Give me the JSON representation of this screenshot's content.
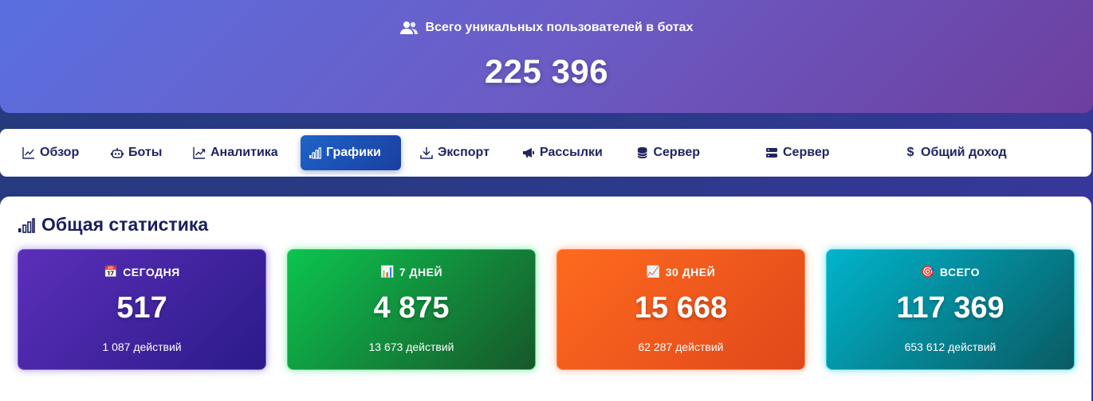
{
  "hero": {
    "icon": "users-icon",
    "label": "Всего уникальных пользователей в ботах",
    "value": "225 396"
  },
  "nav": {
    "tabs": [
      {
        "label": "Обзор",
        "icon": "line-chart-icon",
        "active": false
      },
      {
        "label": "Боты",
        "icon": "robot-icon",
        "active": false
      },
      {
        "label": "Аналитика",
        "icon": "trend-icon",
        "active": false
      },
      {
        "label": "Графики",
        "icon": "signal-bars-icon",
        "active": true
      },
      {
        "label": "Экспорт",
        "icon": "download-icon",
        "active": false
      },
      {
        "label": "Рассылки",
        "icon": "megaphone-icon",
        "active": false
      },
      {
        "label": "Сервер",
        "icon": "database-icon",
        "active": false
      },
      {
        "label": "Сервер",
        "icon": "server-icon",
        "active": false
      },
      {
        "label": "Общий доход",
        "icon": "dollar-icon",
        "active": false
      }
    ],
    "active_color": "#1e5fc6"
  },
  "stats": {
    "title": "Общая статистика",
    "title_icon": "signal-bars-icon",
    "cards": [
      {
        "emoji": "📅",
        "label": "СЕГОДНЯ",
        "value": "517",
        "sub": "1 087 действий",
        "color_from": "#5b2fb8",
        "color_to": "#2b1a8a"
      },
      {
        "emoji": "📊",
        "label": "7 ДНЕЙ",
        "value": "4 875",
        "sub": "13 673 действий",
        "color_from": "#0cc44f",
        "color_to": "#17572a"
      },
      {
        "emoji": "📈",
        "label": "30 ДНЕЙ",
        "value": "15 668",
        "sub": "62 287 действий",
        "color_from": "#ff6a1f",
        "color_to": "#e0481a"
      },
      {
        "emoji": "🎯",
        "label": "ВСЕГО",
        "value": "117 369",
        "sub": "653 612 действий",
        "color_from": "#00b4cc",
        "color_to": "#0a5a62"
      }
    ]
  }
}
